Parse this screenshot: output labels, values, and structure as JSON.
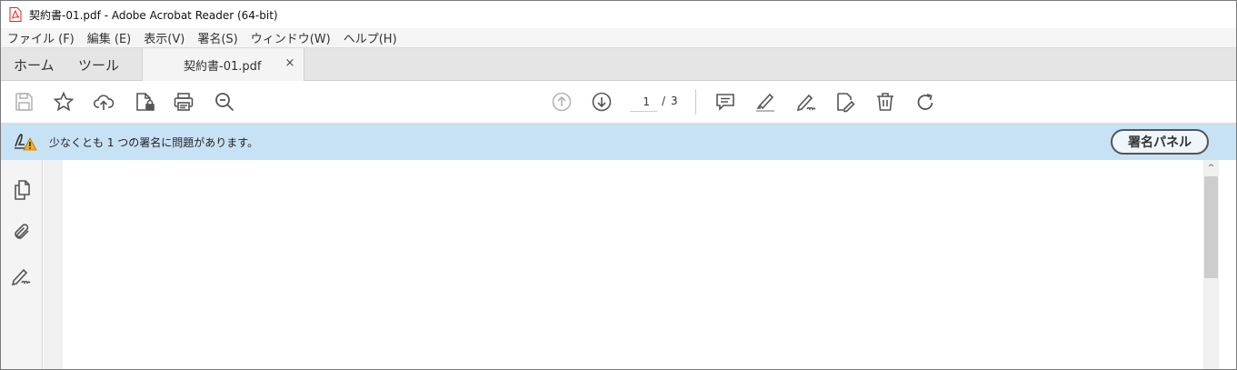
{
  "window": {
    "title": "契約書-01.pdf - Adobe Acrobat Reader (64-bit)",
    "app_icon": "pdf-file-icon"
  },
  "menubar": {
    "items": [
      "ファイル (F)",
      "編集 (E)",
      "表示(V)",
      "署名(S)",
      "ウィンドウ(W)",
      "ヘルプ(H)"
    ]
  },
  "tabs": {
    "home": "ホーム",
    "tools": "ツール",
    "document": "契約書-01.pdf",
    "close_glyph": "×"
  },
  "toolbar": {
    "icons": [
      "save-icon",
      "bookmark-star-icon",
      "upload-cloud-icon",
      "protect-file-icon",
      "print-icon",
      "zoom-search-icon",
      "prev-page-icon",
      "next-page-icon",
      "comment-icon",
      "highlight-icon",
      "fill-sign-icon",
      "edit-pdf-icon",
      "delete-icon",
      "rotate-icon"
    ],
    "page_current": "1",
    "page_separator": "/",
    "page_total": "3"
  },
  "signature_bar": {
    "message": "少なくとも 1 つの署名に問題があります。",
    "panel_button": "署名パネル",
    "background": "#c8e2f5"
  },
  "left_nav": {
    "icons": [
      "pages-icon",
      "attachment-icon",
      "signature-icon"
    ]
  },
  "scrollbar": {
    "up_glyph": "^"
  },
  "colors": {
    "accent_icon": "#555555",
    "disabled_icon": "#b5b5b5",
    "pdf_red": "#d9241c",
    "warning_yellow": "#f3b11b"
  }
}
